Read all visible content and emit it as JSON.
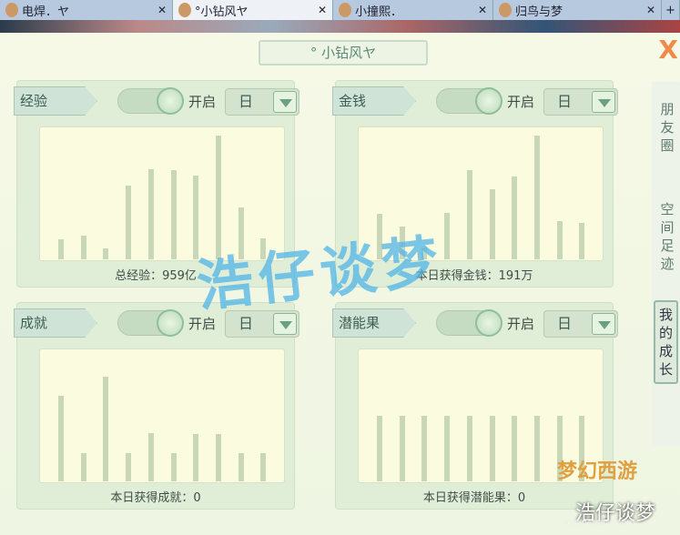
{
  "tabs": [
    {
      "label": "电焊．ヤ",
      "close": "✕"
    },
    {
      "label": "°小钻风ヤ",
      "close": "✕"
    },
    {
      "label": "小撞熙．",
      "close": "✕"
    },
    {
      "label": "归鸟与梦",
      "close": "✕"
    }
  ],
  "tab_add": "+",
  "window": {
    "title": "°  小钻风ヤ",
    "close": "X"
  },
  "panels": [
    {
      "label": "经验",
      "toggle": "开启",
      "period": "日",
      "caption": "总经验：959亿",
      "values": [
        22,
        26,
        12,
        81,
        99,
        98,
        92,
        136,
        57,
        23
      ]
    },
    {
      "label": "金钱",
      "toggle": "开启",
      "period": "日",
      "caption": "本日获得金钱：191万",
      "values": [
        50,
        36,
        13,
        51,
        98,
        77,
        91,
        136,
        42,
        40
      ]
    },
    {
      "label": "成就",
      "toggle": "开启",
      "period": "日",
      "caption": "本日获得成就：0",
      "values": [
        94,
        31,
        115,
        31,
        53,
        31,
        52,
        52,
        31,
        31
      ]
    },
    {
      "label": "潜能果",
      "toggle": "开启",
      "period": "日",
      "caption": "本日获得潜能果：0",
      "values": [
        72,
        72,
        72,
        72,
        72,
        72,
        72,
        72,
        72,
        72
      ]
    }
  ],
  "side": [
    "朋友圈",
    "空间足迹",
    "我的成长"
  ],
  "watermark": "浩仔谈梦",
  "logo": {
    "game": "梦幻西游",
    "text": "浩仔谈梦",
    "url": "xyq.netease.com"
  }
}
